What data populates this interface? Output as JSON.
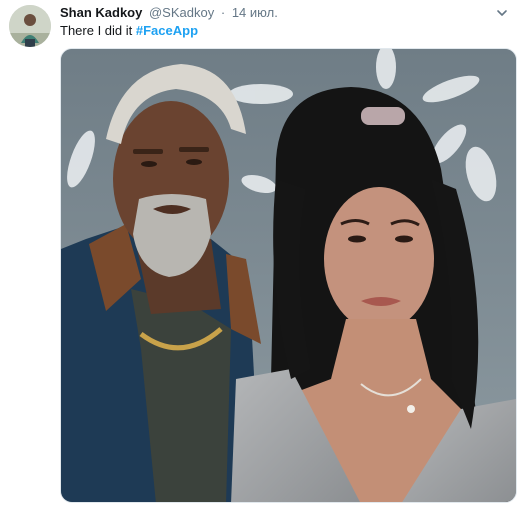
{
  "tweet": {
    "author": {
      "display_name": "Shan Kadkoy",
      "handle": "@SKadkoy",
      "avatar_icon": "profile-avatar"
    },
    "separator": "·",
    "timestamp": "14 июл.",
    "text": "There I did it",
    "hashtag": "#FaceApp",
    "menu_icon": "chevron-down-icon",
    "media": {
      "type": "photo",
      "icon": "photo-image"
    }
  },
  "colors": {
    "name": "#14171a",
    "secondary": "#657786",
    "link": "#1da1f2",
    "border": "#e1e8ed",
    "photo_background": "#7f8b92"
  }
}
